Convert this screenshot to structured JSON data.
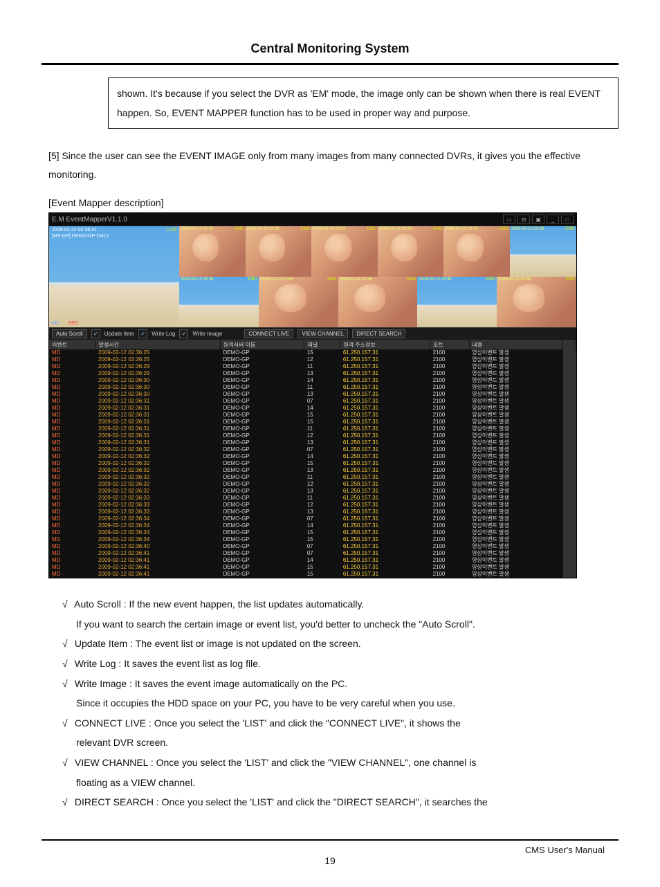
{
  "header": {
    "title": "Central Monitoring System"
  },
  "note_box": "shown.   It's because if you select the DVR as 'EM' mode, the image only can be shown when there is real EVENT happen. So, EVENT MAPPER function has to be used in proper way and purpose.",
  "para5": "[5] Since the user can see the EVENT IMAGE only from many images from many connected DVRs, it gives you the effective monitoring.",
  "em_desc": "[Event Mapper description]",
  "screenshot": {
    "titlebar": "E.M  EventMapperV1.1.0",
    "main_overlay": {
      "ts": "2009-02-12 02:36:41",
      "ch": "[MS-GP] DEMO-GP-CH15",
      "tr": "LIVE",
      "md": "MD",
      "rec": "REC"
    },
    "thumb_label": "2009-02-12 03:36",
    "thumb_ch": "[MS-GP] DEMO-GP-CH",
    "thumb_tag": "EMD",
    "toolbar": {
      "auto_scroll": "Auto Scroll",
      "update_item": "Update Item",
      "write_log": "Write Log",
      "write_image": "Write Image",
      "connect_live": "CONNECT LIVE",
      "view_channel": "VIEW CHANNEL",
      "direct_search": "DIRECT SEARCH"
    },
    "table_headers": [
      "이벤트",
      "발생시간",
      "원격서버 이름",
      "채널",
      "원격 주소정보",
      "포트",
      "내용"
    ],
    "rows": [
      {
        "evt": "MD",
        "ts": "2009-02-12 02:36:25",
        "srv": "DEMO-GP",
        "ch": "15",
        "ip": "61.250.157.31",
        "port": "2100",
        "desc": "영상이벤트 발생"
      },
      {
        "evt": "MD",
        "ts": "2009-02-12 02:36:25",
        "srv": "DEMO-GP",
        "ch": "12",
        "ip": "61.250.157.31",
        "port": "2100",
        "desc": "영상이벤트 발생"
      },
      {
        "evt": "MD",
        "ts": "2009-02-12 02:36:29",
        "srv": "DEMO-GP",
        "ch": "11",
        "ip": "61.250.157.31",
        "port": "2100",
        "desc": "영상이벤트 발생"
      },
      {
        "evt": "MD",
        "ts": "2009-02-12 02:36:29",
        "srv": "DEMO-GP",
        "ch": "13",
        "ip": "61.250.157.31",
        "port": "2100",
        "desc": "영상이벤트 발생"
      },
      {
        "evt": "MD",
        "ts": "2009-02-12 02:36:30",
        "srv": "DEMO-GP",
        "ch": "14",
        "ip": "61.250.157.31",
        "port": "2100",
        "desc": "영상이벤트 발생"
      },
      {
        "evt": "MD",
        "ts": "2009-02-12 02:36:30",
        "srv": "DEMO-GP",
        "ch": "11",
        "ip": "61.250.157.31",
        "port": "2100",
        "desc": "영상이벤트 발생"
      },
      {
        "evt": "MD",
        "ts": "2009-02-12 02:36:30",
        "srv": "DEMO-GP",
        "ch": "13",
        "ip": "61.250.157.31",
        "port": "2100",
        "desc": "영상이벤트 발생"
      },
      {
        "evt": "MD",
        "ts": "2009-02-12 02:36:31",
        "srv": "DEMO-GP",
        "ch": "07",
        "ip": "61.250.157.31",
        "port": "2100",
        "desc": "영상이벤트 발생"
      },
      {
        "evt": "MD",
        "ts": "2009-02-12 02:36:31",
        "srv": "DEMO-GP",
        "ch": "14",
        "ip": "61.250.157.31",
        "port": "2100",
        "desc": "영상이벤트 발생"
      },
      {
        "evt": "MD",
        "ts": "2009-02-12 02:36:31",
        "srv": "DEMO-GP",
        "ch": "15",
        "ip": "61.250.157.31",
        "port": "2100",
        "desc": "영상이벤트 발생"
      },
      {
        "evt": "MD",
        "ts": "2009-02-12 02:36:31",
        "srv": "DEMO-GP",
        "ch": "15",
        "ip": "61.250.157.31",
        "port": "2100",
        "desc": "영상이벤트 발생"
      },
      {
        "evt": "MD",
        "ts": "2009-02-12 02:36:31",
        "srv": "DEMO-GP",
        "ch": "11",
        "ip": "61.250.157.31",
        "port": "2100",
        "desc": "영상이벤트 발생"
      },
      {
        "evt": "MD",
        "ts": "2009-02-12 02:36:31",
        "srv": "DEMO-GP",
        "ch": "12",
        "ip": "61.250.157.31",
        "port": "2100",
        "desc": "영상이벤트 발생"
      },
      {
        "evt": "MD",
        "ts": "2009-02-12 02:36:31",
        "srv": "DEMO-GP",
        "ch": "13",
        "ip": "61.250.157.31",
        "port": "2100",
        "desc": "영상이벤트 발생"
      },
      {
        "evt": "MD",
        "ts": "2009-02-12 02:36:32",
        "srv": "DEMO-GP",
        "ch": "07",
        "ip": "61.250.157.31",
        "port": "2100",
        "desc": "영상이벤트 발생"
      },
      {
        "evt": "MD",
        "ts": "2009-02-12 02:36:32",
        "srv": "DEMO-GP",
        "ch": "14",
        "ip": "61.250.157.31",
        "port": "2100",
        "desc": "영상이벤트 발생"
      },
      {
        "evt": "MD",
        "ts": "2009-02-12 02:36:32",
        "srv": "DEMO-GP",
        "ch": "15",
        "ip": "61.250.157.31",
        "port": "2100",
        "desc": "영상이벤트 발생"
      },
      {
        "evt": "MD",
        "ts": "2009-02-12 02:36:32",
        "srv": "DEMO-GP",
        "ch": "13",
        "ip": "61.250.157.31",
        "port": "2100",
        "desc": "영상이벤트 발생"
      },
      {
        "evt": "MD",
        "ts": "2009-02-12 02:36:32",
        "srv": "DEMO-GP",
        "ch": "11",
        "ip": "61.250.157.31",
        "port": "2100",
        "desc": "영상이벤트 발생"
      },
      {
        "evt": "MD",
        "ts": "2009-02-12 02:36:32",
        "srv": "DEMO-GP",
        "ch": "12",
        "ip": "61.250.157.31",
        "port": "2100",
        "desc": "영상이벤트 발생"
      },
      {
        "evt": "MD",
        "ts": "2009-02-12 02:36:32",
        "srv": "DEMO-GP",
        "ch": "13",
        "ip": "61.250.157.31",
        "port": "2100",
        "desc": "영상이벤트 발생"
      },
      {
        "evt": "MD",
        "ts": "2009-02-12 02:36:33",
        "srv": "DEMO-GP",
        "ch": "11",
        "ip": "61.250.157.31",
        "port": "2100",
        "desc": "영상이벤트 발생"
      },
      {
        "evt": "MD",
        "ts": "2009-02-12 02:36:33",
        "srv": "DEMO-GP",
        "ch": "12",
        "ip": "61.250.157.31",
        "port": "2100",
        "desc": "영상이벤트 발생"
      },
      {
        "evt": "MD",
        "ts": "2009-02-12 02:36:33",
        "srv": "DEMO-GP",
        "ch": "13",
        "ip": "61.250.157.31",
        "port": "2100",
        "desc": "영상이벤트 발생"
      },
      {
        "evt": "MD",
        "ts": "2009-02-12 02:36:34",
        "srv": "DEMO-GP",
        "ch": "07",
        "ip": "61.250.157.31",
        "port": "2100",
        "desc": "영상이벤트 발생"
      },
      {
        "evt": "MD",
        "ts": "2009-02-12 02:36:34",
        "srv": "DEMO-GP",
        "ch": "14",
        "ip": "61.250.157.31",
        "port": "2100",
        "desc": "영상이벤트 발생"
      },
      {
        "evt": "MD",
        "ts": "2009-02-12 02:36:34",
        "srv": "DEMO-GP",
        "ch": "15",
        "ip": "61.250.157.31",
        "port": "2100",
        "desc": "영상이벤트 발생"
      },
      {
        "evt": "MD",
        "ts": "2009-02-12 02:36:34",
        "srv": "DEMO-GP",
        "ch": "15",
        "ip": "61.250.157.31",
        "port": "2100",
        "desc": "영상이벤트 발생"
      },
      {
        "evt": "MD",
        "ts": "2009-02-12 02:36:40",
        "srv": "DEMO-GP",
        "ch": "07",
        "ip": "61.250.157.31",
        "port": "2100",
        "desc": "영상이벤트 발생"
      },
      {
        "evt": "MD",
        "ts": "2009-02-12 02:36:41",
        "srv": "DEMO-GP",
        "ch": "07",
        "ip": "61.250.157.31",
        "port": "2100",
        "desc": "영상이벤트 발생"
      },
      {
        "evt": "MD",
        "ts": "2009-02-12 02:36:41",
        "srv": "DEMO-GP",
        "ch": "14",
        "ip": "61.250.157.31",
        "port": "2100",
        "desc": "영상이벤트 발생"
      },
      {
        "evt": "MD",
        "ts": "2009-02-12 02:36:41",
        "srv": "DEMO-GP",
        "ch": "15",
        "ip": "61.250.157.31",
        "port": "2100",
        "desc": "영상이벤트 발생"
      },
      {
        "evt": "MD",
        "ts": "2009-02-12 02:36:41",
        "srv": "DEMO-GP",
        "ch": "15",
        "ip": "61.250.157.31",
        "port": "2100",
        "desc": "영상이벤트 발생"
      }
    ]
  },
  "bullets": [
    {
      "check": true,
      "text": "Auto Scroll : If the new event happen, the list updates automatically."
    },
    {
      "check": false,
      "text": "If you want to search the certain image or event list, you'd better to uncheck the \"Auto Scroll\"."
    },
    {
      "check": true,
      "text": "Update Item : The event list or image is not updated on the screen."
    },
    {
      "check": true,
      "text": "Write Log : It saves the event list as log file."
    },
    {
      "check": true,
      "text": "Write Image : It saves the event image automatically on the PC."
    },
    {
      "check": false,
      "text": "Since it occupies the HDD space on your PC, you have to be very careful when you use."
    },
    {
      "check": true,
      "text": "CONNECT LIVE : Once you select the 'LIST' and click the \"CONNECT LIVE\", it shows the"
    },
    {
      "check": false,
      "text": "relevant DVR screen."
    },
    {
      "check": true,
      "text": "VIEW CHANNEL : Once you select the 'LIST' and click the \"VIEW CHANNEL\", one channel is"
    },
    {
      "check": false,
      "text": "floating as a VIEW channel."
    },
    {
      "check": true,
      "text": "DIRECT SEARCH : Once you select the 'LIST' and click the \"DIRECT SEARCH\", it searches the"
    }
  ],
  "footer": {
    "manual": "CMS User's Manual",
    "page": "19"
  }
}
